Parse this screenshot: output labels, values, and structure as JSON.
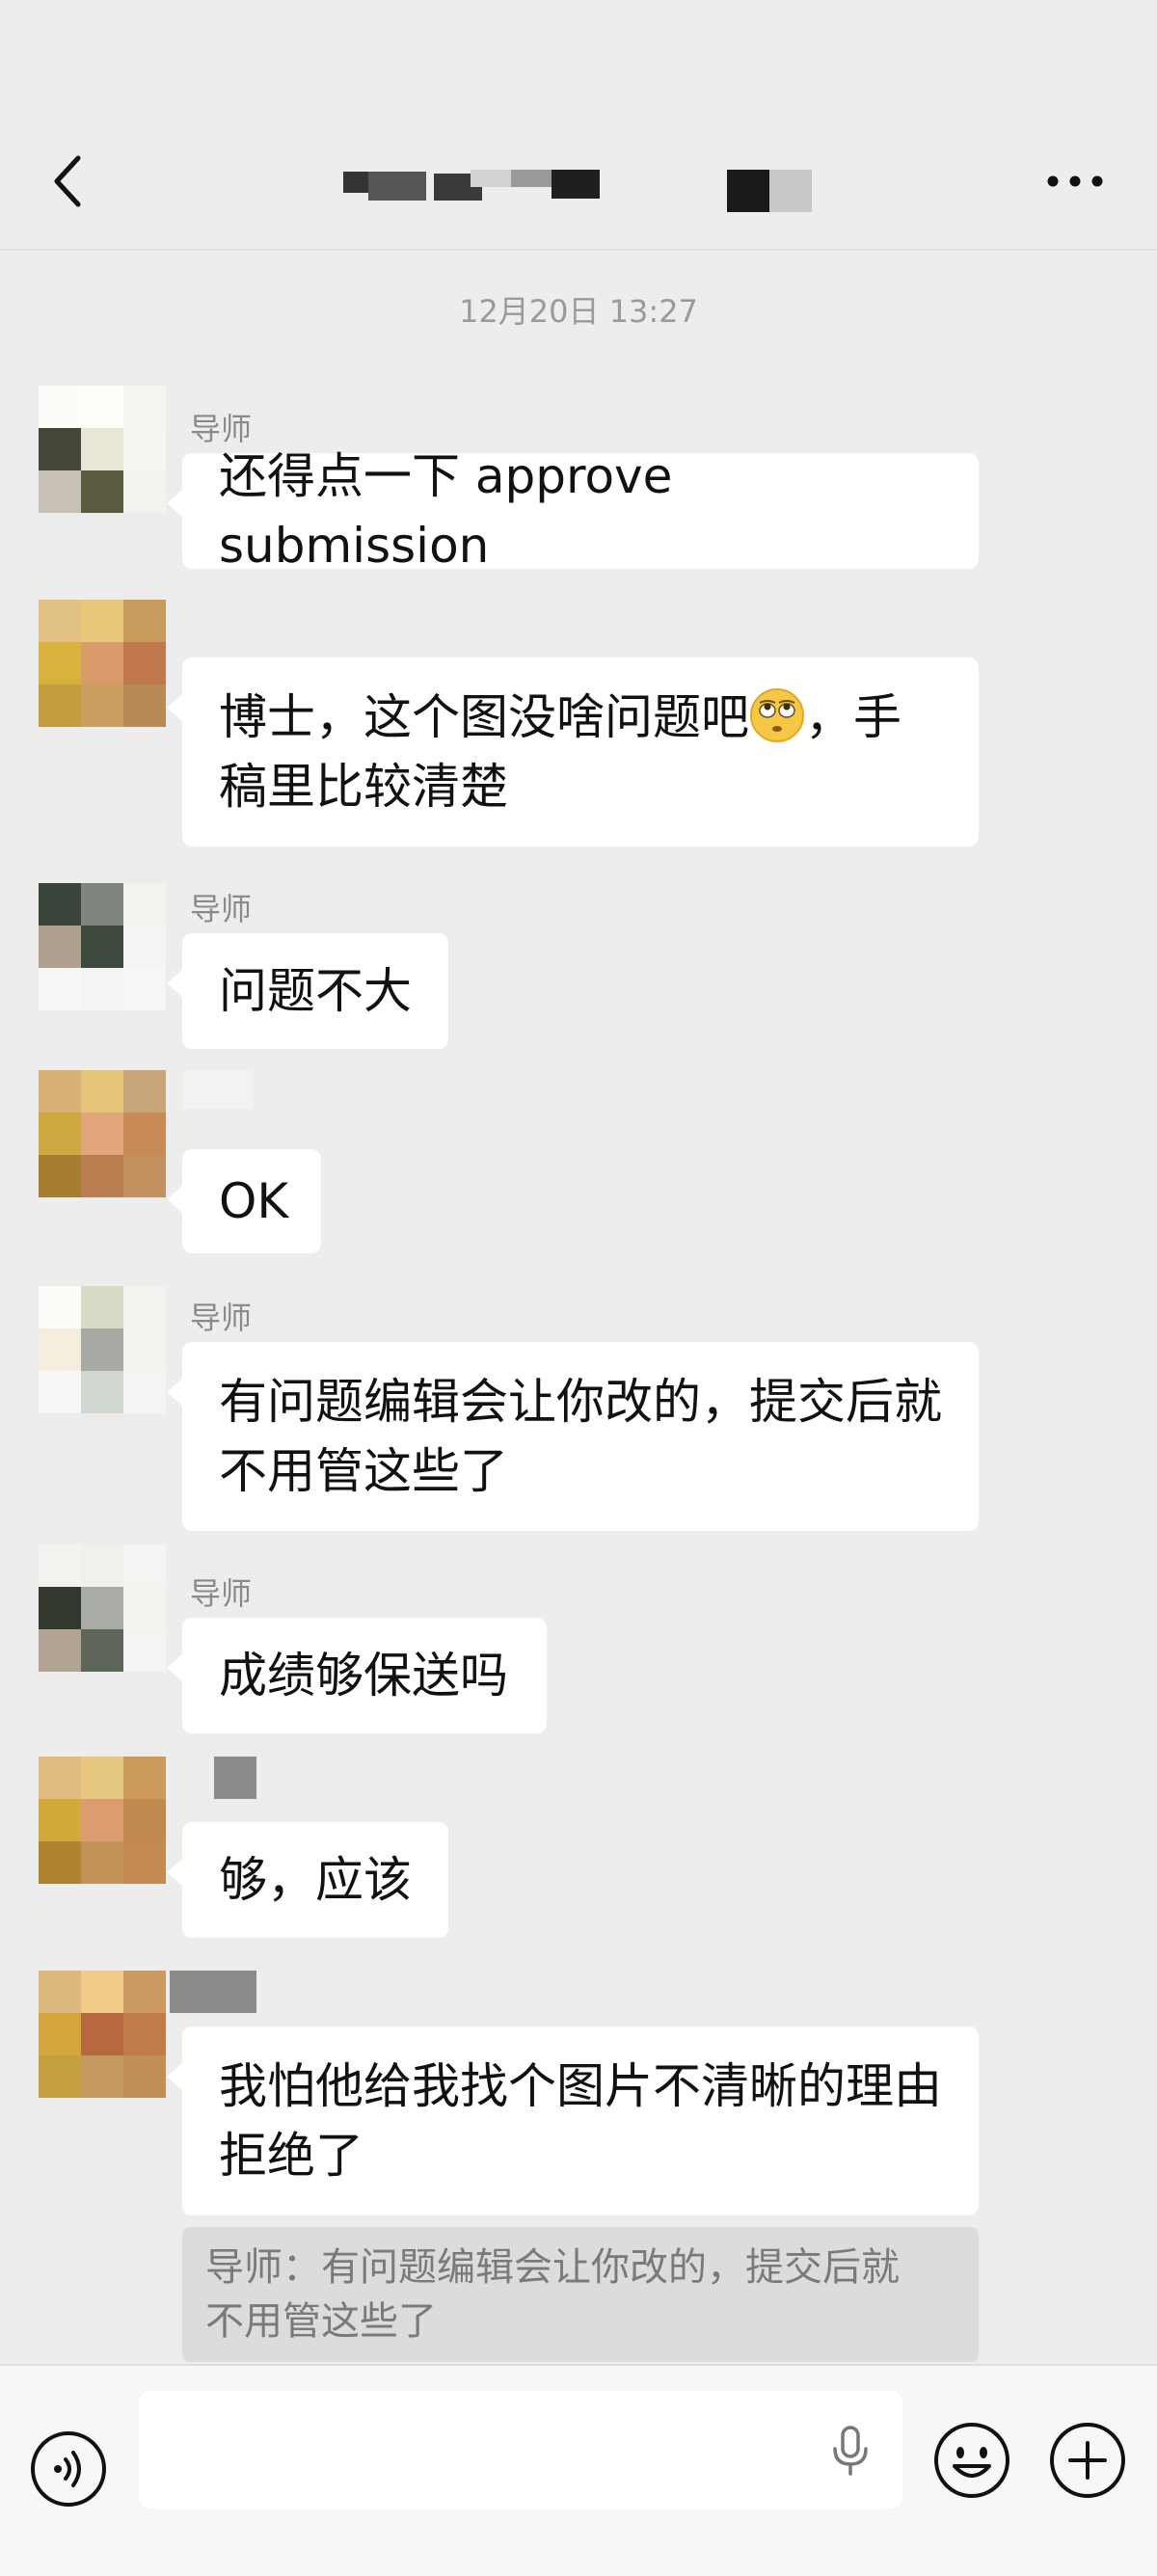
{
  "header": {
    "back_icon": "chevron-left-icon",
    "more_icon": "more-dots-icon",
    "title_obscured": true
  },
  "chat": {
    "timestamp": "12月20日 13:27",
    "messages": [
      {
        "sender": "导师",
        "text": "还得点一下 approve submission"
      },
      {
        "sender": "",
        "text_before_emoji": "博士，这个图没啥问题吧",
        "emoji": "rolling-eyes-emoji",
        "text_after_emoji": "，手",
        "text_line2": "稿里比较清楚"
      },
      {
        "sender": "导师",
        "text": "问题不大"
      },
      {
        "sender": "",
        "text": "OK"
      },
      {
        "sender": "导师",
        "text_line1": "有问题编辑会让你改的，提交后就",
        "text_line2": "不用管这些了"
      },
      {
        "sender": "导师",
        "text": "成绩够保送吗"
      },
      {
        "sender": "",
        "text": "够，应该"
      },
      {
        "sender": "",
        "text_line1": "我怕他给我找个图片不清晰的理由",
        "text_line2": "拒绝了"
      }
    ],
    "quote": {
      "line1": "导师：有问题编辑会让你改的，提交后就",
      "line2": "不用管这些了"
    }
  },
  "input_bar": {
    "voice_icon": "voice-mode-icon",
    "mic_icon": "microphone-icon",
    "emoji_icon": "emoji-icon",
    "plus_icon": "plus-icon",
    "input_value": ""
  }
}
